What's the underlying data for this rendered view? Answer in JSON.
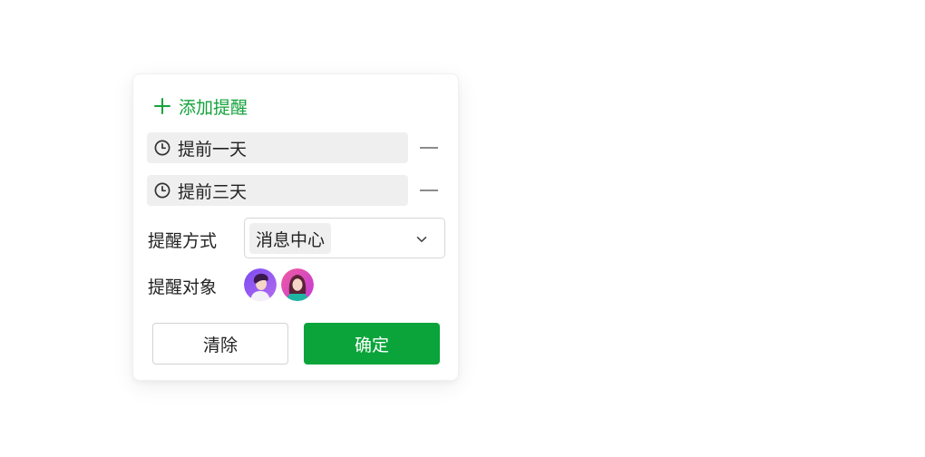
{
  "popover": {
    "add_reminder_label": "添加提醒",
    "reminders": [
      {
        "label": "提前一天",
        "icon": "clock-icon"
      },
      {
        "label": "提前三天",
        "icon": "clock-icon"
      }
    ],
    "method": {
      "label": "提醒方式",
      "selected": "消息中心"
    },
    "target": {
      "label": "提醒对象",
      "avatars": [
        "avatar-male",
        "avatar-female"
      ]
    },
    "clear_label": "清除",
    "confirm_label": "确定"
  },
  "colors": {
    "accent": "#14a33c",
    "primary_button": "#0aa43a",
    "chip_bg": "#efefef"
  }
}
